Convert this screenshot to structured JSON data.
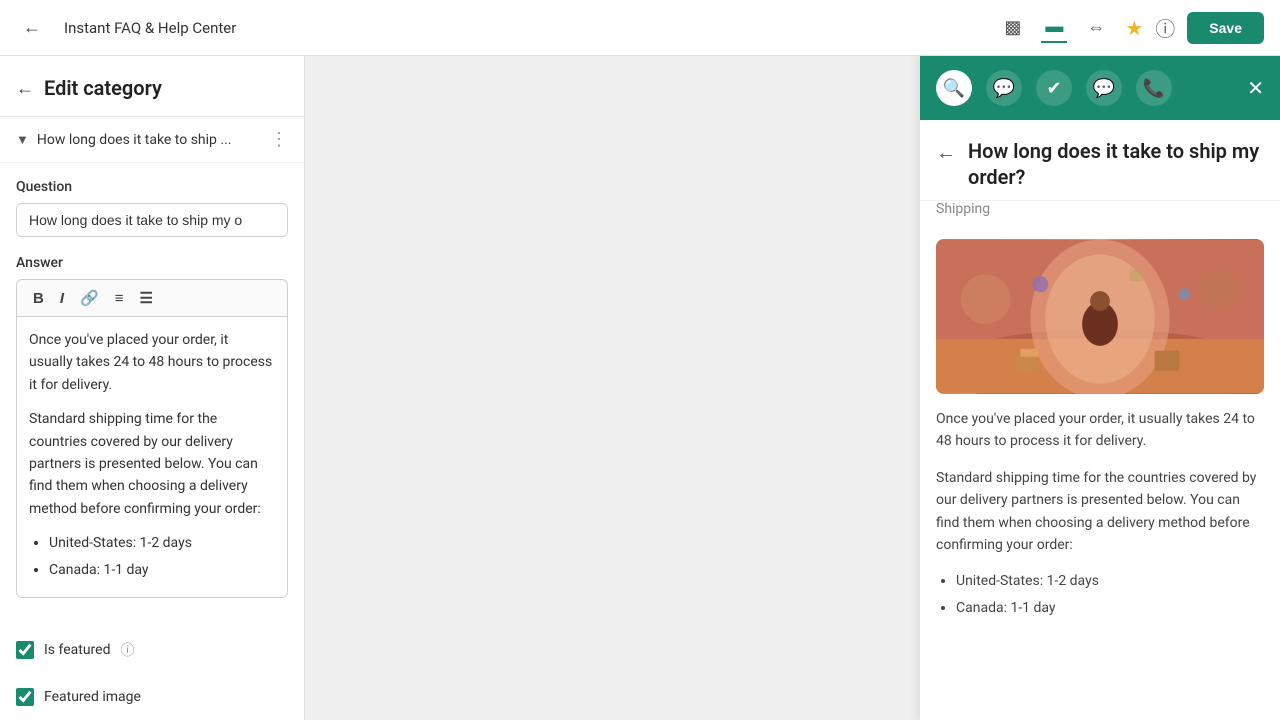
{
  "topbar": {
    "back_icon": "←",
    "title": "Instant FAQ & Help Center",
    "device_icons": [
      {
        "name": "mobile",
        "symbol": "▭",
        "active": false
      },
      {
        "name": "desktop",
        "symbol": "▬",
        "active": true
      },
      {
        "name": "resize",
        "symbol": "⇔",
        "active": false
      }
    ],
    "star_icon": "★",
    "help_icon": "?",
    "save_label": "Save"
  },
  "left_panel": {
    "back_icon": "←",
    "title": "Edit category",
    "category": {
      "chevron": "▾",
      "label": "How long does it take to ship ...",
      "dots": "⋮"
    },
    "question_label": "Question",
    "question_value": "How long does it take to ship my o",
    "answer_label": "Answer",
    "answer_toolbar": {
      "bold": "B",
      "italic": "I",
      "link": "🔗",
      "bullet": "≡",
      "ordered": "☰"
    },
    "answer_paragraphs": [
      "Once you've placed your order, it usually takes 24 to 48 hours to process it for delivery.",
      "Standard shipping time for the countries covered by our delivery partners is presented below. You can find them when choosing a delivery method before confirming your order:"
    ],
    "answer_bullets": [
      "United-States: 1-2 days",
      "Canada: 1-1 day"
    ],
    "is_featured_label": "Is featured",
    "featured_image_label": "Featured image"
  },
  "preview": {
    "close_icon": "✕",
    "icons": [
      "🔍",
      "💬",
      "✈",
      "💬",
      "📞"
    ],
    "back_icon": "←",
    "question": "How long does it take to ship my order?",
    "category_tag": "Shipping",
    "body_paragraphs": [
      "Once you've placed your order, it usually takes 24 to 48 hours to process it for delivery.",
      "Standard shipping time for the countries covered by our delivery partners is presented below. You can find them when choosing a delivery method before confirming your order:"
    ],
    "body_bullets": [
      "United-States: 1-2 days",
      "Canada: 1-1 day"
    ]
  },
  "colors": {
    "brand": "#1a8a6e",
    "save_btn": "#1a8a6e",
    "checkbox": "#1a8a6e"
  }
}
